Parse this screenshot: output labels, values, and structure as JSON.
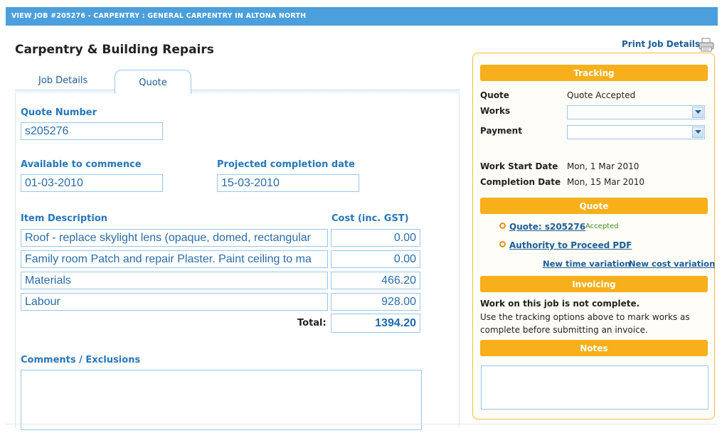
{
  "window": {
    "title": "VIEW JOB #205276 - CARPENTRY : GENERAL CARPENTRY IN ALTONA NORTH"
  },
  "page": {
    "heading": "Carpentry & Building Repairs"
  },
  "tabs": [
    {
      "label": "Job Details",
      "active": false
    },
    {
      "label": "Quote",
      "active": true
    }
  ],
  "quote": {
    "number_label": "Quote Number",
    "number_value": "s205276",
    "available_label": "Available to commence",
    "available_value": "01-03-2010",
    "completion_label": "Projected completion date",
    "completion_value": "15-03-2010",
    "item_header": "Item Description",
    "cost_header": "Cost (inc. GST)",
    "items": [
      {
        "description": "Roof - replace skylight lens (opaque, domed, rectangular",
        "cost": "0.00"
      },
      {
        "description": "Family room Patch and repair Plaster. Paint ceiling to ma",
        "cost": "0.00"
      },
      {
        "description": "Materials",
        "cost": "466.20"
      },
      {
        "description": "Labour",
        "cost": "928.00"
      }
    ],
    "total_label": "Total:",
    "total_value": "1394.20",
    "comments_label": "Comments / Exclusions",
    "comments_value": ""
  },
  "sidebar": {
    "print_label": "Print Job Details",
    "tracking": {
      "title": "Tracking",
      "quote_label": "Quote",
      "quote_value": "Quote Accepted",
      "works_label": "Works",
      "works_value": "",
      "payment_label": "Payment",
      "payment_value": "",
      "work_start_label": "Work Start Date",
      "work_start_value": "Mon, 1 Mar 2010",
      "completion_label": "Completion Date",
      "completion_value": "Mon, 15 Mar 2010"
    },
    "quote_section": {
      "title": "Quote",
      "quote_link": "Quote: s205276",
      "quote_status": "Accepted",
      "authority_link": "Authority to Proceed PDF",
      "time_variation_link": "New time variation",
      "cost_variation_link": "New cost variation"
    },
    "invoicing": {
      "title": "Invoicing",
      "status": "Work on this job is not complete.",
      "help": "Use the tracking options above to mark works as complete before submitting an invoice."
    },
    "notes": {
      "title": "Notes",
      "value": ""
    }
  },
  "colors": {
    "topbar": "#4a9fdc",
    "accent_orange": "#f7b01b",
    "link_blue": "#1d5d95",
    "field_text": "#2a6ca8"
  },
  "icons": {
    "print": "printer-icon",
    "dropdown": "chevron-down-icon",
    "bullet": "circle-bullet-icon"
  }
}
